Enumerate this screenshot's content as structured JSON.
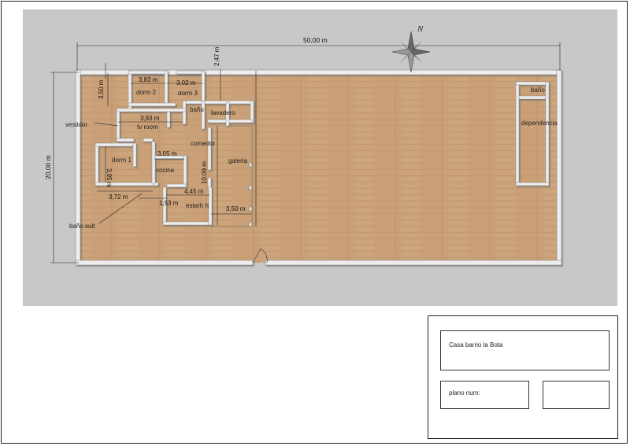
{
  "plan": {
    "overall_width": "50,00 m",
    "overall_depth": "20,00 m",
    "north": "N",
    "rooms": {
      "dorm2": "dorm 2",
      "dorm3": "dorm 3",
      "bano": "baño",
      "lavadero": "lavadero",
      "tvroom": "tv room",
      "vestidor": "vestidor",
      "comedor": "comedor",
      "dorm1": "dorm 1",
      "cocina": "cocina",
      "galeria": "galeria",
      "estarh": "estarh h",
      "banosuit": "baño suit",
      "bano_dep": "baño",
      "dependencia": "dependencia"
    },
    "dims": {
      "d383": "3,83 m",
      "d302": "3,02 m",
      "d247": "2,47 m",
      "d350v": "3,50 m",
      "d393": "3,93 m",
      "d305": "3,05 m",
      "d395": "3,95 m",
      "d1009": "10,09 m",
      "d445": "4,45 m",
      "d372": "3,72 m",
      "d153": "1,53 m",
      "d350h": "3,50 m"
    }
  },
  "title_block": {
    "title": "Casa barrio la Bota",
    "plano_label": "plano num:",
    "blank": ""
  },
  "colors": {
    "ground": "#c8c8c8",
    "floor": "#caa278",
    "wall": "#ececec"
  }
}
